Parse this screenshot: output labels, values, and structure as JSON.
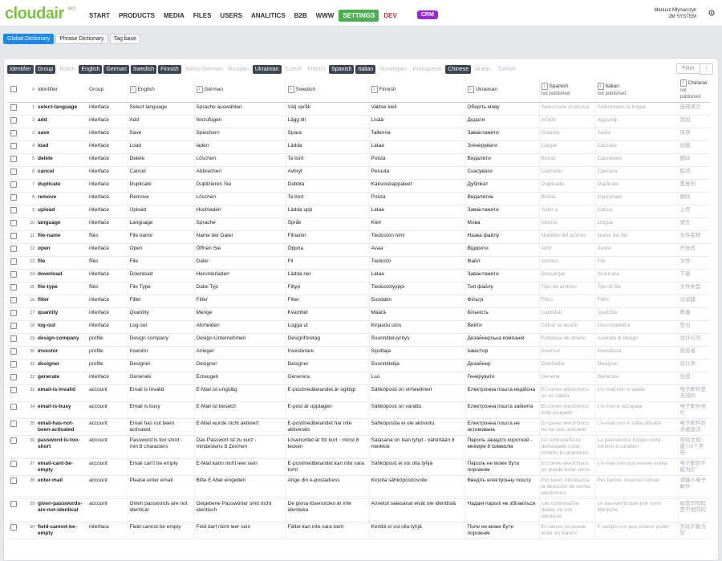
{
  "app": {
    "logo": "cloudair",
    "logo_sup": "tech"
  },
  "nav": [
    "START",
    "PRODUCTS",
    "MEDIA",
    "FILES",
    "USERS",
    "ANALITICS",
    "B2B",
    "WWW",
    "SETTINGS",
    "DEV"
  ],
  "crm": "CRM",
  "user": {
    "name": "Mariusz Młynarczyk",
    "company": "2M SYSTEM"
  },
  "subtabs": [
    "Global Dictionary",
    "Phrase Dictionary",
    "Tag base"
  ],
  "langs": [
    {
      "label": "Identifier",
      "on": true
    },
    {
      "label": "Group",
      "on": true
    },
    {
      "label": "Polish",
      "on": false
    },
    {
      "label": "English",
      "on": true
    },
    {
      "label": "German",
      "on": true
    },
    {
      "label": "Swedish",
      "on": true
    },
    {
      "label": "Finnish",
      "on": true
    },
    {
      "label": "Swiss-German",
      "on": false
    },
    {
      "label": "Russian",
      "on": false
    },
    {
      "label": "Ukrainian",
      "on": true
    },
    {
      "label": "Czech",
      "on": false
    },
    {
      "label": "French",
      "on": false
    },
    {
      "label": "Spanish",
      "on": true
    },
    {
      "label": "Italian",
      "on": true
    },
    {
      "label": "Norwegian",
      "on": false
    },
    {
      "label": "Portuguese",
      "on": false
    },
    {
      "label": "Chinese",
      "on": true
    },
    {
      "label": "Arabic",
      "on": false
    },
    {
      "label": "Turkish",
      "on": false
    }
  ],
  "filter_label": "Filter",
  "more_label": "⋮",
  "headers": {
    "num": "#",
    "identifier": "Identifier",
    "group": "Group",
    "english": "English",
    "german": "German",
    "swedish": "Swedish",
    "finnish": "Finnish",
    "ukrainian": "Ukrainian",
    "spanish": "Spanish",
    "italian": "Italian",
    "chinese": "Chinese",
    "not_published": "not published"
  },
  "rows": [
    [
      "1",
      "select-language",
      "interface",
      "Select language",
      "Sprache auswählen",
      "Välj språk",
      "Valitse kieli",
      "Оберіть мову",
      "Seleccione el idioma",
      "Selezionare la lingua",
      "选择语言"
    ],
    [
      "2",
      "add",
      "interface",
      "Add",
      "hinzufügen",
      "Lägg till",
      "Lisää",
      "Додати",
      "Añadir",
      "Aggiungi",
      "添加"
    ],
    [
      "3",
      "save",
      "interface",
      "Save",
      "Speichern",
      "Spara",
      "Tallenna",
      "Завантажити",
      "Guardar",
      "Salva",
      "保存"
    ],
    [
      "4",
      "load",
      "interface",
      "Load",
      "laden",
      "Ladda",
      "Lataa",
      "Згенерувати",
      "Cargar",
      "Caricare",
      "加载"
    ],
    [
      "5",
      "delete",
      "interface",
      "Delete",
      "Löschen",
      "Ta bort",
      "Poista",
      "Видалити",
      "Borrar",
      "Cancellare",
      "删除"
    ],
    [
      "6",
      "cancel",
      "interface",
      "Cancel",
      "Abbrechen",
      "Avbryt",
      "Peruuta",
      "Скасувати",
      "Cancelar",
      "Cancella",
      "取消"
    ],
    [
      "7",
      "duplicate",
      "interface",
      "Duplicate",
      "Duplizieren Sie",
      "Dubbla",
      "Kaksoiskappaleet",
      "Дублікат",
      "Duplicado",
      "Duplicato",
      "重复的"
    ],
    [
      "8",
      "remove",
      "interface",
      "Remove",
      "Löschen",
      "Ta bort",
      "Poista",
      "Видалитиь",
      "Borrar",
      "Cancellare",
      "删除"
    ],
    [
      "9",
      "upload",
      "interface",
      "Upload",
      "Hochladen",
      "Ladda upp",
      "Lataa",
      "Завантажити",
      "Subir a",
      "Carica",
      "上传"
    ],
    [
      "10",
      "language",
      "interface",
      "Language",
      "Sprache",
      "Språk",
      "Kieli",
      "Мова",
      "Idioma",
      "Lingua",
      "语言"
    ],
    [
      "11",
      "file-name",
      "files",
      "File name",
      "Name der Datei",
      "Filnamn",
      "Tiedoston nimi",
      "Назва файлу",
      "Nombre del archivo",
      "Nome del file",
      "文件名称"
    ],
    [
      "12",
      "open",
      "interface",
      "Open",
      "Öffnen Sie",
      "Öppna",
      "Avaa",
      "Відкрити",
      "Abrir",
      "Aprire",
      "开放式"
    ],
    [
      "13",
      "file",
      "files",
      "File",
      "Datei",
      "Fil",
      "Tiedosto",
      "Файл",
      "Archivo",
      "File",
      "文件"
    ],
    [
      "14",
      "download",
      "interface",
      "Download",
      "Herunterladen",
      "Ladda ner",
      "Lataa",
      "Завантажити",
      "Descargar",
      "Scaricare",
      "下载"
    ],
    [
      "15",
      "file-type",
      "files",
      "File Type",
      "Datei Typ",
      "Filtyp",
      "Tiedostotyyppi",
      "Тип файлу",
      "Tipo de archivo",
      "Tipo di file",
      "文件类型"
    ],
    [
      "16",
      "filter",
      "interface",
      "Filter",
      "Filter",
      "Filter",
      "Suodatin",
      "Фільтр",
      "Filtro",
      "Filtro",
      "过滤器"
    ],
    [
      "17",
      "quantity",
      "interface",
      "Quantity",
      "Menge",
      "Kvantitet",
      "Määrä",
      "Кількість",
      "Cantidad",
      "Quantità",
      "数量"
    ],
    [
      "18",
      "log-out",
      "interface",
      "Log out",
      "Abmelden",
      "Logga ut",
      "Kirjaudu ulos",
      "Вийти",
      "Cerrar la sesión",
      "Disconnettersi",
      "登出"
    ],
    [
      "19",
      "design-company",
      "profile",
      "Design company",
      "Design-Unternehmen",
      "Designföretag",
      "Suunnitteluyritys",
      "Дизайнерська компанія",
      "Empresa de diseño",
      "Azienda di design",
      "设计公司"
    ],
    [
      "20",
      "investor",
      "profile",
      "Investor",
      "Anleger",
      "Investerare",
      "Sijoittaja",
      "Інвестор",
      "Inversor",
      "Investitore",
      "投资者"
    ],
    [
      "21",
      "designer",
      "profile",
      "Designer",
      "Designer",
      "Designer",
      "Suunnittelija",
      "Дизайнер",
      "Diseñador",
      "Designer",
      "设计师"
    ],
    [
      "22",
      "generate",
      "interface",
      "Generate",
      "Erzeugen",
      "Generera",
      "Luo",
      "Генерувати",
      "Generar",
      "Generare",
      "生成"
    ],
    [
      "23",
      "email-is-invalid",
      "account",
      "Email is invalid",
      "E-Mail ist ungültig",
      "E-postmeddelandet är ogiltigt",
      "Sähköposti on virheellinen",
      "Електронна пошта недійсна",
      "El correo electrónico no es válido",
      "L'e-mail non è valida",
      "电子邮件是无效的"
    ],
    [
      "24",
      "email-is-busy",
      "account",
      "Email is busy",
      "E-Mail ist besetzt",
      "E-post är upptagen",
      "Sähköposti on varattu",
      "Електронна пошта зайнята",
      "El correo electrónico está ocupado",
      "L'e-mail è occupata",
      "电子邮件很忙"
    ],
    [
      "25",
      "email-has-not-been-activated",
      "account",
      "Email has not been activated",
      "E-Mail wurde nicht aktiviert",
      "E-postmeddelandet har inte aktiverats",
      "Sähköpostia ei ole aktivoitu",
      "Електронна пошта не активована",
      "El correo electrónico no ha sido activado",
      "L'e-mail non è stata attivata",
      "电子邮件尚未被激活"
    ],
    [
      "26",
      "password-is-too-short",
      "account",
      "Password is too short - min 8 characters",
      "Das Passwort ist zu kurz - mindestens 8 Zeichen",
      "Lösenordet är för kort - minst 8 tecken",
      "Salasana on liian lyhyt - vähintään 8 merkkiä",
      "Пароль занадто короткий - мінімум 8 символів",
      "La contraseña es demasiado corta - mínimo 8 caracteres",
      "La password è troppo corta - minimo 8 caratteri",
      "密码太短 - 最少8个字符"
    ],
    [
      "27",
      "email-cant-be-empty",
      "account",
      "Email can't be empty",
      "E-Mail kann nicht leer sein",
      "E-postmeddelandet kan inte vara tomt",
      "Sähköposti ei voi olla tyhjä",
      "Пароль не може бути порожнім",
      "El correo electrónico no puede estar vacío",
      "L'e-mail non può essere vuota",
      "电子邮件不能为空"
    ],
    [
      "28",
      "enter-mail",
      "account",
      "Please enter email",
      "Bitte E-Mail eingeben",
      "Ange din e-postadress",
      "Kirjoita sähköpostiosoite",
      "Введіть електронну пошту",
      "Por favor, introduzca la dirección de correo electrónico",
      "Per favore, inserisci l'email",
      "请输入电子邮件"
    ],
    [
      "29",
      "given-passwords-are-not-identical",
      "account",
      "Given passwords are not identical",
      "Gegebene Passwörter sind nicht identisch",
      "De givna lösenorden är inte identiska",
      "Annetut salasanat eivät ole identtisiä",
      "Надані паролі не збігаються",
      "Las contraseñas dadas no son idénticas",
      "Le password date non sono identiche",
      "给定的密码是不相同的"
    ],
    [
      "30",
      "field-cannot-be-empty",
      "interface",
      "Field cannot be empty",
      "Feld darf nicht leer sein",
      "Fältet kan inte vara tomt",
      "Kenttä ei voi olla tyhjä",
      "Поле не може бути порожнім",
      "El campo no puede estar en blanco",
      "Il campo non può essere vuoto",
      "字段不能为空"
    ]
  ]
}
